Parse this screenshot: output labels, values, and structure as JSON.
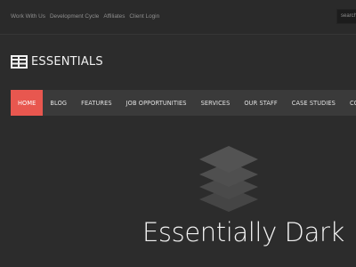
{
  "topbar": {
    "links": [
      "Work With Us",
      "Development Cycle",
      "Affiliates",
      "Client Login"
    ],
    "search_placeholder": "search"
  },
  "logo": {
    "icon": "table-grid-icon",
    "text": "ESSENTIALS"
  },
  "nav": {
    "items": [
      "HOME",
      "BLOG",
      "FEATURES",
      "JOB OPPORTUNITIES",
      "SERVICES",
      "OUR STAFF",
      "CASE STUDIES",
      "CONTACT"
    ],
    "active_index": 0,
    "active_color": "#e8574f"
  },
  "hero": {
    "icon": "layers-stack-icon",
    "title": "Essentially Dark"
  }
}
